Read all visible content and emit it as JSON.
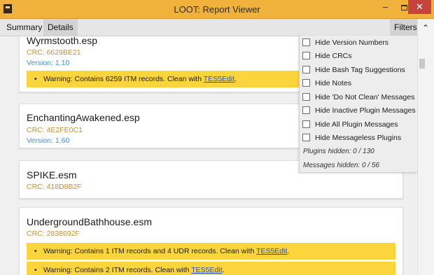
{
  "window": {
    "title": "LOOT: Report Viewer",
    "close_glyph": "✕"
  },
  "tabs": {
    "summary": "Summary",
    "details": "Details",
    "filters": "Filters"
  },
  "plugins": [
    {
      "name": "Wyrmstooth.esp",
      "crc": "CRC: 6629BE21",
      "version": "Version: 1.10",
      "messages": [
        {
          "bullet": "•",
          "text": "Warning: Contains 6259 ITM records. Clean with ",
          "link": "TES5Edit",
          "tail": "."
        }
      ]
    },
    {
      "name": "EnchantingAwakened.esp",
      "crc": "CRC: 4E2FE0C1",
      "version": "Version: 1.60",
      "messages": []
    },
    {
      "name": "SPIKE.esm",
      "crc": "CRC: 418D8B2F",
      "messages": []
    },
    {
      "name": "UndergroundBathhouse.esm",
      "crc": "CRC: 2838692F",
      "messages": [
        {
          "bullet": "•",
          "text": "Warning: Contains 1 ITM records and 4 UDR records. Clean with ",
          "link": "TES5Edit",
          "tail": "."
        },
        {
          "bullet": "•",
          "text": "Warning: Contains 2 ITM records. Clean with ",
          "link": "TES5Edit",
          "tail": "."
        }
      ]
    }
  ],
  "filters": {
    "options": [
      {
        "label": "Hide Version Numbers",
        "checked": false
      },
      {
        "label": "Hide CRCs",
        "checked": false
      },
      {
        "label": "Hide Bash Tag Suggestions",
        "checked": false
      },
      {
        "label": "Hide Notes",
        "checked": false
      },
      {
        "label": "Hide 'Do Not Clean' Messages",
        "checked": false
      },
      {
        "label": "Hide Inactive Plugin Messages",
        "checked": false
      },
      {
        "label": "Hide All Plugin Messages",
        "checked": false
      },
      {
        "label": "Hide Messageless Plugins",
        "checked": false
      }
    ],
    "plugins_hidden": "Plugins hidden: 0 / 130",
    "messages_hidden": "Messages hidden: 0 / 56"
  },
  "icons": {
    "app": "loot-app-icon",
    "minimize": "minimize-icon",
    "maximize": "maximize-icon",
    "close": "close-icon",
    "scroll_up": "chevron-up-icon"
  },
  "colors": {
    "titlebar": "#f0b23a",
    "warning_bg": "#fbd53b",
    "crc": "#c89134",
    "version": "#4a8fd8",
    "close_button": "#c7423a"
  }
}
